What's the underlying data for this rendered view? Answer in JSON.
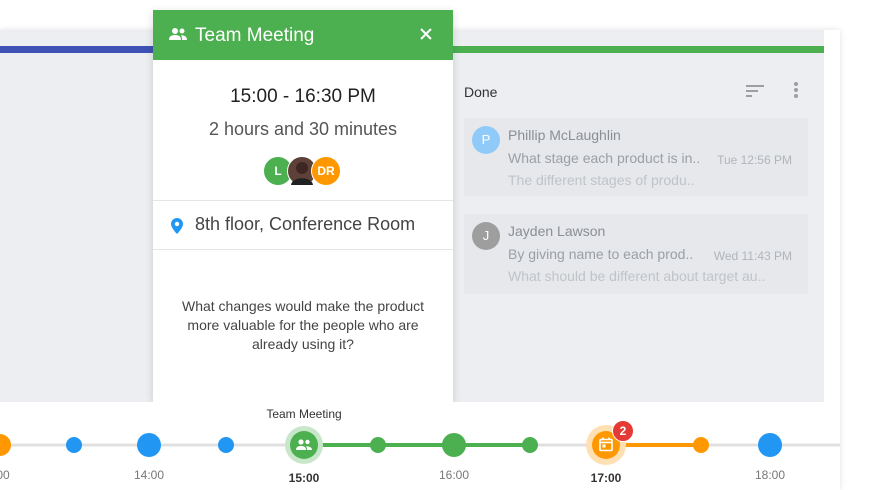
{
  "popup": {
    "title": "Team Meeting",
    "time_range": "15:00 - 16:30 PM",
    "duration": "2 hours and 30 minutes",
    "attendees": [
      {
        "initials": "L",
        "color": "#4caf50"
      },
      {
        "initials": "",
        "color": "#5d4037"
      },
      {
        "initials": "DR",
        "color": "#ff9800"
      }
    ],
    "location": "8th floor, Conference Room",
    "question": "What changes would make the product more valuable for the people who are already using it?"
  },
  "column": {
    "header": "Done",
    "cards": [
      {
        "initial": "P",
        "avatar_color": "#90caf9",
        "name": "Phillip McLaughlin",
        "message": "What stage each product is in..",
        "time": "Tue 12:56 PM",
        "sub": "The different stages of produ.."
      },
      {
        "initial": "J",
        "avatar_color": "#9e9e9e",
        "name": "Jayden Lawson",
        "message": "By giving name to each prod..",
        "time": "Wed 11:43 PM",
        "sub": "What should be different about target au.."
      }
    ]
  },
  "timeline": {
    "event_title": "Team Meeting",
    "labels": {
      "l0": "00",
      "l1": "14:00",
      "l2": "15:00",
      "l3": "16:00",
      "l4": "17:00",
      "l5": "18:00"
    },
    "badge_count": "2",
    "colors": {
      "blue": "#2196f3",
      "green": "#4caf50",
      "orange": "#ff9800",
      "track": "#e0e0e0"
    }
  }
}
